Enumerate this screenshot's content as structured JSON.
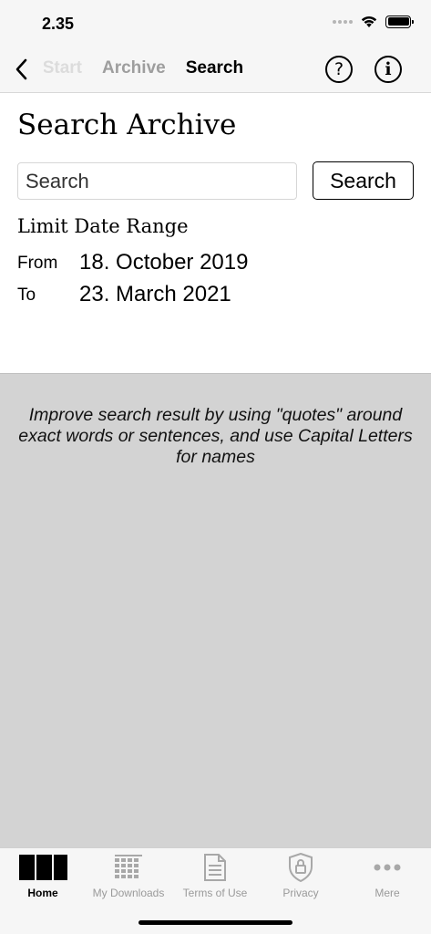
{
  "status_bar": {
    "time": "2.35",
    "icons": [
      "signal-icon",
      "wifi-icon",
      "battery-icon"
    ]
  },
  "nav": {
    "back_icon": "chevron-left-icon",
    "crumbs": [
      {
        "label": "Start",
        "state": "faded"
      },
      {
        "label": "Archive",
        "state": "inactive"
      },
      {
        "label": "Search",
        "state": "active"
      }
    ],
    "help_icon_glyph": "?",
    "info_icon_glyph": "i"
  },
  "search": {
    "title": "Search Archive",
    "input_placeholder": "Search",
    "input_value": "",
    "button_label": "Search",
    "range_heading": "Limit Date Range",
    "from_label": "From",
    "from_value": "18. October 2019",
    "to_label": "To",
    "to_value": "23. March 2021"
  },
  "hint": {
    "text": "Improve search result by using \"quotes\" around exact words or sentences, and use Capital Letters for names"
  },
  "tabs": [
    {
      "label": "Home",
      "icon": "home-icon",
      "active": true
    },
    {
      "label": "My Downloads",
      "icon": "downloads-icon",
      "active": false
    },
    {
      "label": "Terms of Use",
      "icon": "document-icon",
      "active": false
    },
    {
      "label": "Privacy",
      "icon": "privacy-lock-icon",
      "active": false
    },
    {
      "label": "Mere",
      "icon": "more-icon",
      "active": false
    }
  ],
  "colors": {
    "bar_background": "#f6f6f6",
    "hint_background": "#d3d3d3",
    "inactive_gray": "#9e9e9e",
    "faded_gray": "#dcdcdc"
  }
}
